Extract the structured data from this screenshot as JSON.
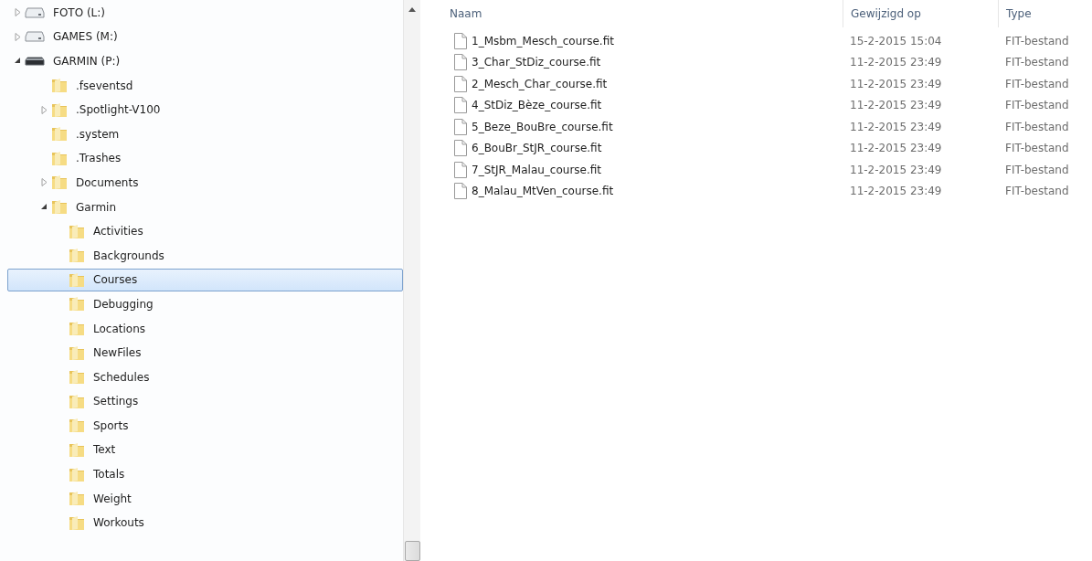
{
  "tree": [
    {
      "label": "FOTO (L:)",
      "kind": "drive",
      "expanded": false,
      "selected": false
    },
    {
      "label": "GAMES (M:)",
      "kind": "drive",
      "expanded": false,
      "selected": false
    },
    {
      "label": "GARMIN (P:)",
      "kind": "removable",
      "expanded": true,
      "selected": false,
      "children": [
        {
          "label": ".fseventsd",
          "kind": "folder",
          "selected": false
        },
        {
          "label": ".Spotlight-V100",
          "kind": "folder",
          "expanded": false,
          "selected": false
        },
        {
          "label": ".system",
          "kind": "folder",
          "selected": false
        },
        {
          "label": ".Trashes",
          "kind": "folder",
          "selected": false
        },
        {
          "label": "Documents",
          "kind": "folder",
          "expanded": false,
          "selected": false
        },
        {
          "label": "Garmin",
          "kind": "folder",
          "expanded": true,
          "selected": false,
          "children": [
            {
              "label": "Activities",
              "kind": "folder",
              "selected": false
            },
            {
              "label": "Backgrounds",
              "kind": "folder",
              "selected": false
            },
            {
              "label": "Courses",
              "kind": "folder",
              "selected": true
            },
            {
              "label": "Debugging",
              "kind": "folder",
              "selected": false
            },
            {
              "label": "Locations",
              "kind": "folder",
              "selected": false
            },
            {
              "label": "NewFiles",
              "kind": "folder",
              "selected": false
            },
            {
              "label": "Schedules",
              "kind": "folder",
              "selected": false
            },
            {
              "label": "Settings",
              "kind": "folder",
              "selected": false
            },
            {
              "label": "Sports",
              "kind": "folder",
              "selected": false
            },
            {
              "label": "Text",
              "kind": "folder",
              "selected": false
            },
            {
              "label": "Totals",
              "kind": "folder",
              "selected": false
            },
            {
              "label": "Weight",
              "kind": "folder",
              "selected": false
            },
            {
              "label": "Workouts",
              "kind": "folder",
              "selected": false
            }
          ]
        }
      ]
    }
  ],
  "file_list": {
    "columns": [
      "Naam",
      "Gewijzigd op",
      "Type"
    ],
    "rows": [
      {
        "name": "1_Msbm_Mesch_course.fit",
        "modified": "15-2-2015 15:04",
        "type": "FIT-bestand"
      },
      {
        "name": "3_Char_StDiz_course.fit",
        "modified": "11-2-2015 23:49",
        "type": "FIT-bestand"
      },
      {
        "name": "2_Mesch_Char_course.fit",
        "modified": "11-2-2015 23:49",
        "type": "FIT-bestand"
      },
      {
        "name": "4_StDiz_Bèze_course.fit",
        "modified": "11-2-2015 23:49",
        "type": "FIT-bestand"
      },
      {
        "name": "5_Beze_BouBre_course.fit",
        "modified": "11-2-2015 23:49",
        "type": "FIT-bestand"
      },
      {
        "name": "6_BouBr_StJR_course.fit",
        "modified": "11-2-2015 23:49",
        "type": "FIT-bestand"
      },
      {
        "name": "7_StJR_Malau_course.fit",
        "modified": "11-2-2015 23:49",
        "type": "FIT-bestand"
      },
      {
        "name": "8_Malau_MtVen_course.fit",
        "modified": "11-2-2015 23:49",
        "type": "FIT-bestand"
      }
    ]
  }
}
